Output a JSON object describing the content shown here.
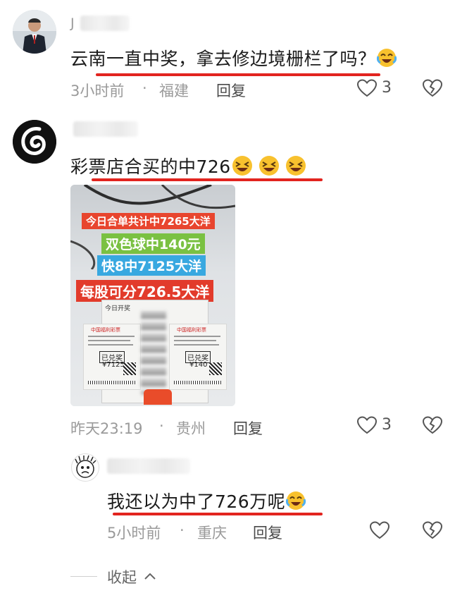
{
  "comment1": {
    "username": "J",
    "text": "云南一直中奖，拿去修边境栅栏了吗？",
    "emoji": "laughing-crying-face",
    "time": "3小时前",
    "location": "福建",
    "reply_label": "回复",
    "like_count": "3"
  },
  "comment2": {
    "text": "彩票店合买的中726",
    "emoji": "squinting-laughing-face",
    "image": {
      "banner1": "今日合单共计中7265大洋",
      "banner2": "双色球中140元",
      "banner3": "快8中7125大洋",
      "banner4": "每股可分726.5大洋",
      "paper_label": "今日开奖",
      "ticket_header": "中国福利彩票",
      "stamp": "已兑奖",
      "ticket1_amount": "¥7125",
      "ticket2_amount": "¥140"
    },
    "time": "昨天23:19",
    "location": "贵州",
    "reply_label": "回复",
    "like_count": "3"
  },
  "comment3": {
    "text": "我还以为中了726万呢",
    "emoji": "laughing-crying-face",
    "time": "5小时前",
    "location": "重庆",
    "reply_label": "回复"
  },
  "collapse_label": "收起",
  "colors": {
    "accent_red": "#e2241f",
    "meta_gray": "#9a9a9a"
  }
}
